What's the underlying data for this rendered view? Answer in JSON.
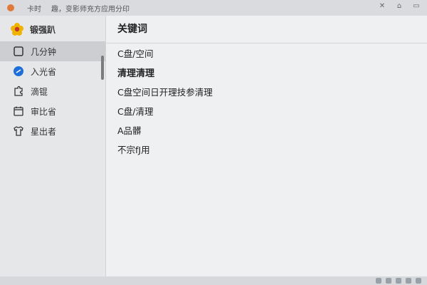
{
  "window": {
    "title_left": "卡时",
    "title_text": "趣，变影师充方应用分印",
    "controls": [
      "minimize-icon",
      "maximize-icon",
      "close-icon"
    ]
  },
  "sidebar": {
    "brand": {
      "name": "锻强趴",
      "logo_icon": "flower-logo-icon"
    },
    "items": [
      {
        "label": "几分钟",
        "icon": "window-icon",
        "active": true
      },
      {
        "label": "入光省",
        "icon": "circle-arrow-icon",
        "active": false
      },
      {
        "label": "滴锟",
        "icon": "puzzle-icon",
        "active": false
      },
      {
        "label": "审比省",
        "icon": "calendar-icon",
        "active": false
      },
      {
        "label": "星出者",
        "icon": "shirt-icon",
        "active": false
      }
    ]
  },
  "main": {
    "header": "关键词",
    "rows": [
      {
        "text": "C盘/空间",
        "bold": false
      },
      {
        "text": "清理清理",
        "bold": true
      },
      {
        "text": "C盘空间日开理技参清理",
        "bold": false
      },
      {
        "text": "C盘/清理",
        "bold": false
      },
      {
        "text": "A品髒",
        "bold": false
      },
      {
        "text": "不宗fJ用",
        "bold": false
      }
    ]
  },
  "colors": {
    "accent": "#1e6fd9",
    "logo": "#f0b400",
    "sidebar_bg": "#e6e7e9",
    "main_bg": "#eef0f2"
  }
}
